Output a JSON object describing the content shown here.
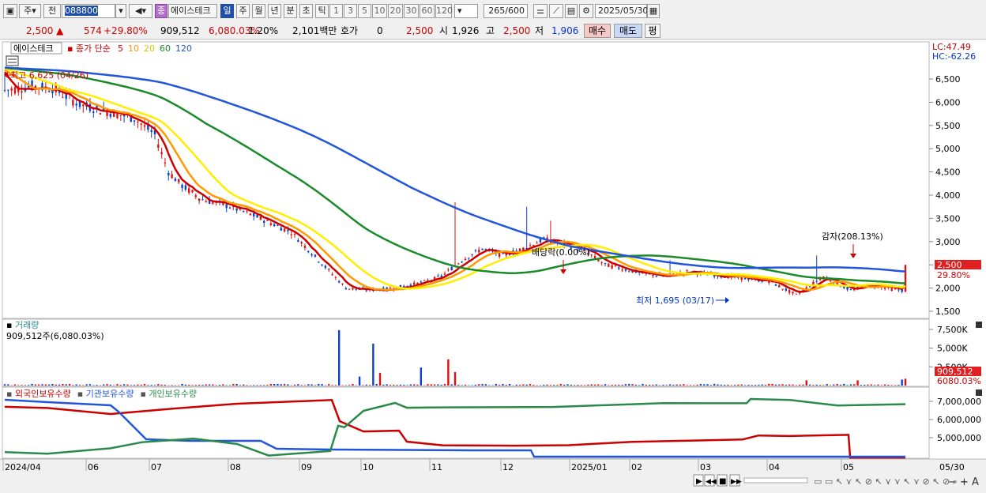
{
  "toolbar": {
    "market": "주",
    "prev": "전",
    "code": "088800",
    "name_badge": "종",
    "stock_name": "에이스테크",
    "periods": [
      "일",
      "주",
      "월",
      "년",
      "분",
      "초",
      "틱"
    ],
    "period_selected": "일",
    "intervals": [
      "1",
      "3",
      "5",
      "10",
      "20",
      "30",
      "60",
      "120"
    ],
    "count": "265",
    "count_total": "/600",
    "date": "2025/05/30"
  },
  "quote": {
    "price": "2,500",
    "change": "574",
    "change_pct": "+29.80%",
    "volume": "909,512",
    "volume_ratio": "6,080.03%",
    "turnover_pct": "1.20%",
    "amount": "2,101백만",
    "hoga_label": "호가",
    "hoga_value": "0",
    "hoga_price": "2,500",
    "open_label": "시",
    "open": "1,926",
    "high_label": "고",
    "high": "2,500",
    "low_label": "저",
    "low": "1,906",
    "buy_label": "매수",
    "sell_label": "매도",
    "eval_label": "평"
  },
  "price_panel": {
    "legend_name": "에이스테크",
    "legend_type": "종가 단순",
    "ma_labels": [
      "5",
      "10",
      "20",
      "60",
      "120"
    ],
    "ma_colors": [
      "#cc0000",
      "#ff9900",
      "#ffee00",
      "#1a8a2a",
      "#2255dd"
    ],
    "lc": "LC:47.49",
    "hc": "HC:-62.26",
    "high_note": "최고 6,625 (04/26)",
    "low_note": "최저 1,695 (03/17)",
    "div_note": "배당락(0.00%)",
    "reduce_note": "감자(208.13%)",
    "last_price_tag": "2,500",
    "last_pct_tag": "29.80%",
    "y_ticks": [
      "6,500",
      "6,000",
      "5,500",
      "5,000",
      "4,500",
      "4,000",
      "3,500",
      "3,000",
      "2,500",
      "2,000",
      "1,500"
    ]
  },
  "volume_panel": {
    "title": "거래량",
    "sub": "909,512주(6,080.03%)",
    "y_ticks": [
      "7,500K",
      "5,000K",
      "2,500K"
    ],
    "last_tag": "909,512",
    "last_pct_tag": "6080.03%"
  },
  "holder_panel": {
    "legend": [
      "외국인보유수량",
      "기관보유수량",
      "개인보유수량"
    ],
    "legend_colors": [
      "#cc0000",
      "#2255dd",
      "#2a8a4a"
    ],
    "y_ticks": [
      "7,000,000",
      "6,000,000",
      "5,000,000"
    ]
  },
  "x_axis": [
    "2024/04",
    "06",
    "07",
    "08",
    "09",
    "10",
    "11",
    "12",
    "2025/01",
    "02",
    "03",
    "04",
    "05",
    "05/30"
  ],
  "chart_data": {
    "type": "line",
    "title": "에이스테크",
    "x": [
      "2024/04",
      "06",
      "07",
      "08",
      "09",
      "10",
      "11",
      "12",
      "2025/01",
      "02",
      "03",
      "04",
      "05",
      "05/30"
    ],
    "series": [
      {
        "name": "종가",
        "values": [
          6300,
          5800,
          4000,
          3000,
          1950,
          2600,
          3100,
          2350,
          2250,
          2300,
          2050,
          2000,
          2100,
          2500
        ]
      },
      {
        "name": "120",
        "values": [
          6800,
          6800,
          6100,
          5000,
          4300,
          3800,
          3400,
          2900,
          2700,
          2500,
          2400,
          2300,
          2200,
          2150
        ]
      },
      {
        "name": "60",
        "values": [
          6700,
          6300,
          5500,
          4200,
          3000,
          2450,
          2350,
          2400,
          2450,
          2400,
          2300,
          2200,
          2150,
          2050
        ]
      }
    ],
    "ylim": [
      1500,
      6800
    ],
    "volume_last": 909512,
    "holdings": [
      {
        "name": "외국인보유수량",
        "values": [
          6700000,
          6600000,
          6750000,
          6900000,
          6900000,
          5600000,
          4800000,
          4800000,
          4850000,
          4850000,
          4900000,
          5150000,
          5150000,
          3600000
        ]
      },
      {
        "name": "기관보유수량",
        "values": [
          7000000,
          6900000,
          5000000,
          4900000,
          4500000,
          4500000,
          4450000,
          4450000,
          3700000,
          3700000,
          3700000,
          3650000,
          3650000,
          3650000
        ]
      },
      {
        "name": "개인보유수량",
        "values": [
          4300000,
          4500000,
          5000000,
          4800000,
          4300000,
          6800000,
          7000000,
          7000000,
          6950000,
          7000000,
          6950000,
          7050000,
          6950000,
          6900000
        ]
      }
    ]
  }
}
